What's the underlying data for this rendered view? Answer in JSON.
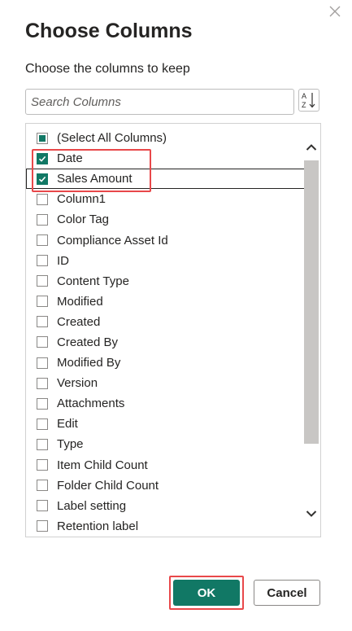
{
  "dialog": {
    "title": "Choose Columns",
    "subtitle": "Choose the columns to keep",
    "close_icon": "close-icon"
  },
  "search": {
    "placeholder": "Search Columns",
    "value": "",
    "sort_icon": "sort-az-icon"
  },
  "columns": [
    {
      "label": "(Select All Columns)",
      "state": "partial"
    },
    {
      "label": "Date",
      "state": "checked"
    },
    {
      "label": "Sales Amount",
      "state": "checked",
      "focused": true
    },
    {
      "label": "Column1",
      "state": "unchecked"
    },
    {
      "label": "Color Tag",
      "state": "unchecked"
    },
    {
      "label": "Compliance Asset Id",
      "state": "unchecked"
    },
    {
      "label": "ID",
      "state": "unchecked"
    },
    {
      "label": "Content Type",
      "state": "unchecked"
    },
    {
      "label": "Modified",
      "state": "unchecked"
    },
    {
      "label": "Created",
      "state": "unchecked"
    },
    {
      "label": "Created By",
      "state": "unchecked"
    },
    {
      "label": "Modified By",
      "state": "unchecked"
    },
    {
      "label": "Version",
      "state": "unchecked"
    },
    {
      "label": "Attachments",
      "state": "unchecked"
    },
    {
      "label": "Edit",
      "state": "unchecked"
    },
    {
      "label": "Type",
      "state": "unchecked"
    },
    {
      "label": "Item Child Count",
      "state": "unchecked"
    },
    {
      "label": "Folder Child Count",
      "state": "unchecked"
    },
    {
      "label": "Label setting",
      "state": "unchecked"
    },
    {
      "label": "Retention label",
      "state": "unchecked"
    }
  ],
  "buttons": {
    "ok_label": "OK",
    "cancel_label": "Cancel"
  },
  "colors": {
    "accent": "#117865",
    "highlight": "#e8484a"
  }
}
